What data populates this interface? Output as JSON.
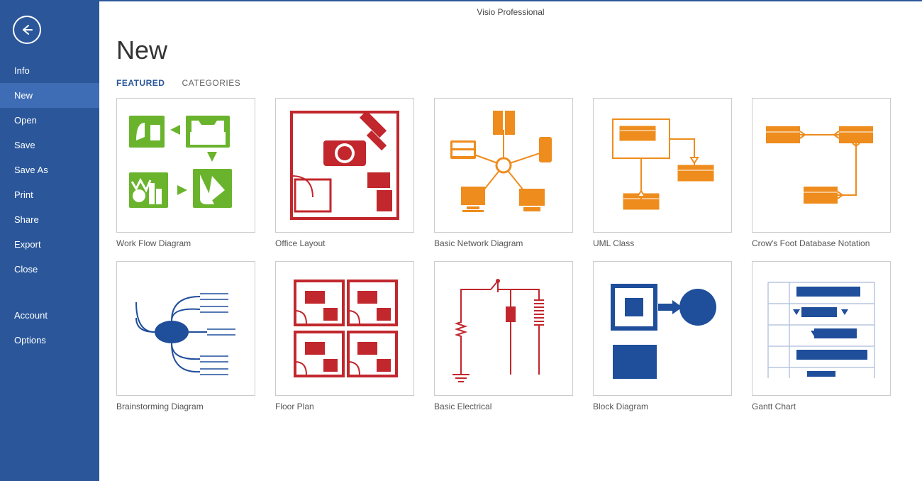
{
  "app_title": "Visio Professional",
  "page_title": "New",
  "sidebar": {
    "items": [
      {
        "label": "Info",
        "selected": false
      },
      {
        "label": "New",
        "selected": true
      },
      {
        "label": "Open",
        "selected": false
      },
      {
        "label": "Save",
        "selected": false
      },
      {
        "label": "Save As",
        "selected": false
      },
      {
        "label": "Print",
        "selected": false
      },
      {
        "label": "Share",
        "selected": false
      },
      {
        "label": "Export",
        "selected": false
      },
      {
        "label": "Close",
        "selected": false
      }
    ],
    "footer_items": [
      {
        "label": "Account"
      },
      {
        "label": "Options"
      }
    ]
  },
  "tabs": [
    {
      "label": "FEATURED",
      "active": true
    },
    {
      "label": "CATEGORIES",
      "active": false
    }
  ],
  "templates": [
    {
      "label": "Work Flow Diagram",
      "icon": "workflow",
      "color": "#6ab42d"
    },
    {
      "label": "Office Layout",
      "icon": "office",
      "color": "#c1272d"
    },
    {
      "label": "Basic Network Diagram",
      "icon": "network",
      "color": "#ee8c1d"
    },
    {
      "label": "UML Class",
      "icon": "uml",
      "color": "#ee8c1d"
    },
    {
      "label": "Crow's Foot Database Notation",
      "icon": "crowfoot",
      "color": "#ee8c1d"
    },
    {
      "label": "Brainstorming Diagram",
      "icon": "brainstorm",
      "color": "#1f4e9b"
    },
    {
      "label": "Floor Plan",
      "icon": "floorplan",
      "color": "#c1272d"
    },
    {
      "label": "Basic Electrical",
      "icon": "electrical",
      "color": "#c1272d"
    },
    {
      "label": "Block Diagram",
      "icon": "block",
      "color": "#1f4e9b"
    },
    {
      "label": "Gantt Chart",
      "icon": "gantt",
      "color": "#1f4e9b"
    }
  ]
}
